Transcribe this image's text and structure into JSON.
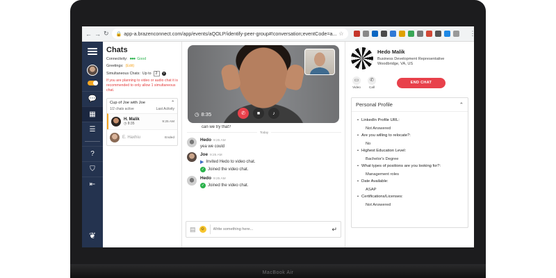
{
  "device": {
    "model": "MacBook Air"
  },
  "browser": {
    "url": "app-a.brazenconnect.com/app/events/aQOLP/identify-peer-group#!conversation;eventCode=a...",
    "icons": [
      "back-icon",
      "forward-icon",
      "reload-icon",
      "lock-icon",
      "star-icon",
      "menu-icon"
    ]
  },
  "rail": {
    "icons": [
      "hamburger-icon",
      "calendar-icon",
      "document-icon",
      "help-icon",
      "shield-icon",
      "logout-icon",
      "brand-logo-icon"
    ],
    "colors": {
      "bg": "#24334f",
      "accent": "#f5a623"
    }
  },
  "chats": {
    "title": "Chats",
    "connectivity_label": "Connectivity:",
    "connectivity_value": "Good",
    "greetings_label": "Greetings:",
    "greetings_edit": "(Edit)",
    "simultaneous_label": "Simultaneous Chats:",
    "simultaneous_prefix": "Up to",
    "simultaneous_value": "2",
    "warning": "If you are planning to video or audio chat it is recommended to only allow 1 simultaneous chat.",
    "group": {
      "title": "Cup of Joe with Joe",
      "active": "1/2 chats active",
      "last_activity": "Last Activity"
    },
    "items": [
      {
        "name": "H. Malik",
        "sub": "8:35",
        "time": "9:25 AM"
      },
      {
        "name": "E. Haxhiu",
        "sub": "",
        "time": "Ended"
      }
    ]
  },
  "video": {
    "timer": "8:35",
    "controls": [
      "end-call",
      "camera",
      "microphone"
    ]
  },
  "messages": {
    "fragment": "can we try that?",
    "divider": "Today",
    "items": [
      {
        "author": "Hedo",
        "time": "9:25 AM",
        "lines": [
          "yea we could"
        ]
      },
      {
        "author": "Joe",
        "time": "9:25 AM",
        "lines": [
          "Invited Hedo to video chat.",
          "Joined the video chat."
        ]
      },
      {
        "author": "Hedo",
        "time": "9:25 AM",
        "lines": [
          "Joined the video chat."
        ]
      }
    ]
  },
  "composer": {
    "placeholder": "Write something here..."
  },
  "profile": {
    "name": "Hedo Malik",
    "title": "Business Development Representative",
    "location": "Woodbridge, VA, US",
    "video_label": "Video",
    "call_label": "Call",
    "end_chat": "END CHAT",
    "section_title": "Personal Profile",
    "qa": [
      {
        "q": "LinkedIn Profile URL:",
        "a": "Not Answered"
      },
      {
        "q": "Are you willing to relocate?:",
        "a": "No"
      },
      {
        "q": "Highest Education Level:",
        "a": "Bachelor's Degree"
      },
      {
        "q": "What types of positions are you looking for?:",
        "a": "Management roles"
      },
      {
        "q": "Date Available:",
        "a": "ASAP"
      },
      {
        "q": "Certifications/Licenses:",
        "a": "Not Answered"
      }
    ]
  }
}
